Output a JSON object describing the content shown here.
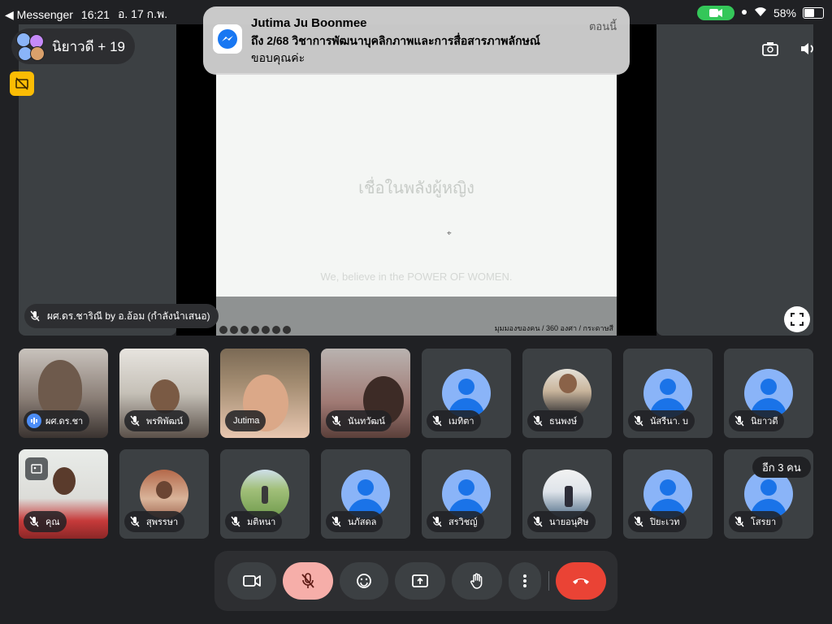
{
  "status_bar": {
    "back_app": "◀ Messenger",
    "time": "16:21",
    "date": "อ. 17 ก.พ.",
    "battery": "58%"
  },
  "meeting": {
    "title": "นิยาวดี + 19"
  },
  "notification": {
    "sender": "Jutima Ju Boonmee",
    "time": "ตอนนี้",
    "line1": "ถึง 2/68 วิชาการพัฒนาบุคลิกภาพและการสื่อสารภาพลักษณ์",
    "line2": "ขอบคุณค่ะ"
  },
  "slide": {
    "title": "เชื่อในพลังผู้หญิง",
    "subtitle": "We, believe in the POWER OF WOMEN.",
    "footer": "มุมมองของคน / 360 องศา / กระดาษสี"
  },
  "presenter": {
    "label": "ผศ.ดร.ชาริณี by อ.อ้อม (กำลังนำเสนอ)"
  },
  "participants_row1": [
    {
      "name": "ผศ.ดร.ชา",
      "kind": "video",
      "mic": "speaking"
    },
    {
      "name": "พรพิพัฒน์",
      "kind": "video",
      "mic": "muted"
    },
    {
      "name": "Jutima",
      "kind": "video",
      "mic": "none"
    },
    {
      "name": "นันทวัฒน์",
      "kind": "video",
      "mic": "muted"
    },
    {
      "name": "เมทิตา",
      "kind": "default",
      "mic": "muted"
    },
    {
      "name": "ธนพงษ์",
      "kind": "photo",
      "mic": "muted"
    },
    {
      "name": "นัสรีนา. บ",
      "kind": "default",
      "mic": "muted"
    },
    {
      "name": "นิยาวดี",
      "kind": "default",
      "mic": "muted"
    }
  ],
  "participants_row2": [
    {
      "name": "คุณ",
      "kind": "video",
      "mic": "muted"
    },
    {
      "name": "สุพรรษา",
      "kind": "photo",
      "mic": "muted"
    },
    {
      "name": "มติหนา",
      "kind": "photo",
      "mic": "muted"
    },
    {
      "name": "นภัสดล",
      "kind": "default",
      "mic": "muted"
    },
    {
      "name": "สรวิชญ์",
      "kind": "default",
      "mic": "muted"
    },
    {
      "name": "นายอนุศิษ",
      "kind": "photo",
      "mic": "muted"
    },
    {
      "name": "ปิยะเวท",
      "kind": "default",
      "mic": "muted"
    },
    {
      "name": "โสรยา",
      "kind": "default",
      "mic": "muted"
    }
  ],
  "more_people": "อีก 3 คน",
  "colors": {
    "background": "#202124",
    "tile": "#3c4043",
    "end_call": "#ea4335",
    "mic_off_active": "#f6aea9",
    "default_avatar_bg": "#8ab4f8",
    "default_avatar_fg": "#1a73e8"
  },
  "controls": {
    "camera": "video-icon",
    "mic": "mic-off-icon",
    "reactions": "emoji-icon",
    "present": "present-screen-icon",
    "raise_hand": "hand-icon",
    "more": "more-vert-icon",
    "end_call": "end-call-icon"
  }
}
